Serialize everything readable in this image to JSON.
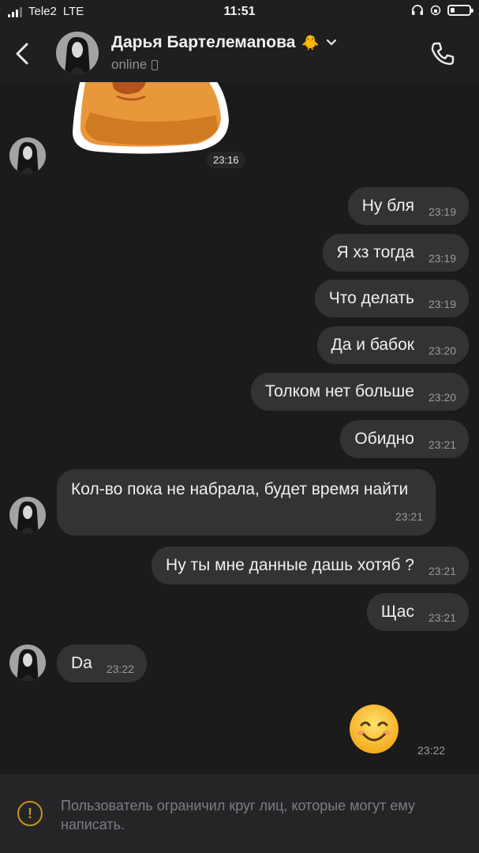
{
  "status_bar": {
    "carrier": "Tele2",
    "network": "LTE",
    "time": "11:51"
  },
  "header": {
    "back_icon": "chevron-left-icon",
    "contact_name": "Дарья Бартелемanова",
    "name_emoji": "🐥",
    "status": "online",
    "call_icon": "phone-icon"
  },
  "messages": [
    {
      "direction": "in",
      "type": "sticker",
      "time": "23:16"
    },
    {
      "direction": "out",
      "text": "Ну бля",
      "time": "23:19"
    },
    {
      "direction": "out",
      "text": "Я хз тогда",
      "time": "23:19"
    },
    {
      "direction": "out",
      "text": "Что делать",
      "time": "23:19"
    },
    {
      "direction": "out",
      "text": "Да и бабок",
      "time": "23:20"
    },
    {
      "direction": "out",
      "text": "Толком нет больше",
      "time": "23:20"
    },
    {
      "direction": "out",
      "text": "Обидно",
      "time": "23:21"
    },
    {
      "direction": "in",
      "text": "Кол-во пока не набрала, будет время найти",
      "time": "23:21"
    },
    {
      "direction": "out",
      "text": "Ну ты мне данные дашь хотяб ?",
      "time": "23:21"
    },
    {
      "direction": "out",
      "text": "Щас",
      "time": "23:21"
    },
    {
      "direction": "in",
      "text": "Da",
      "time": "23:22"
    },
    {
      "direction": "out",
      "type": "emoji",
      "text": "😊",
      "time": "23:22"
    }
  ],
  "notice": {
    "icon": "warning-circle-icon",
    "text": "Пользователь ограничил круг лиц, которые могут ему написать."
  },
  "colors": {
    "background": "#1b1b1c",
    "bubble": "#333335",
    "notice_icon": "#c8971c"
  }
}
